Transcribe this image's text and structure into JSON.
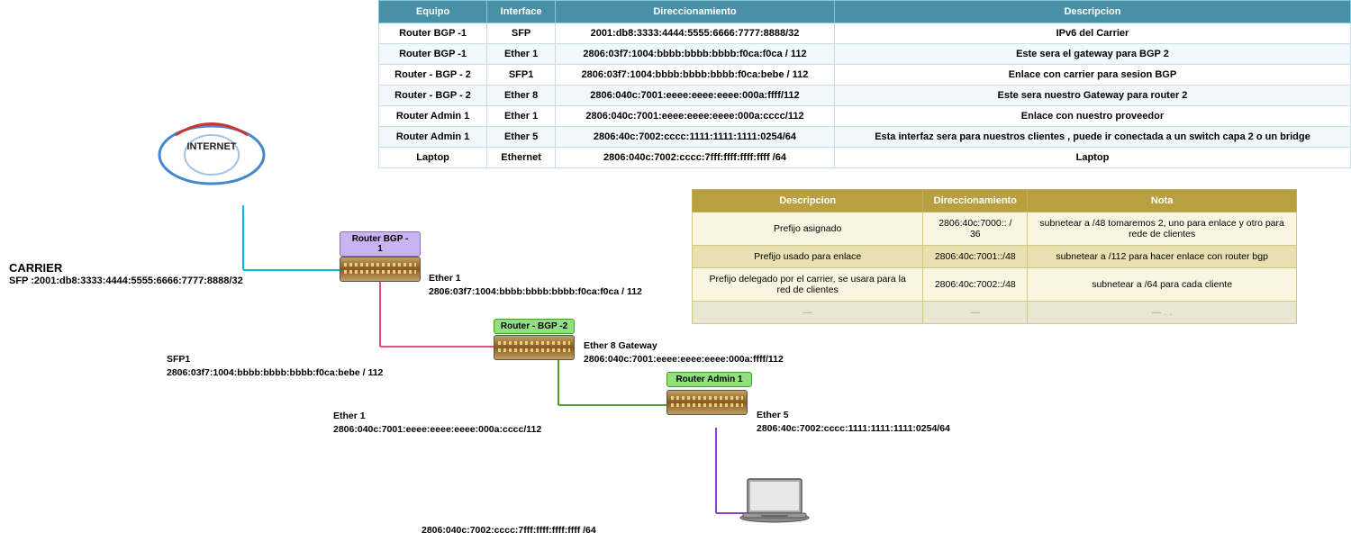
{
  "table1": {
    "headers": [
      "Equipo",
      "Interface",
      "Direccionamiento",
      "Descripcion"
    ],
    "rows": [
      {
        "equipo": "Router BGP -1",
        "interface": "SFP",
        "direccionamiento": "2001:db8:3333:4444:5555:6666:7777:8888/32",
        "descripcion": "IPv6 del Carrier"
      },
      {
        "equipo": "Router BGP -1",
        "interface": "Ether 1",
        "direccionamiento": "2806:03f7:1004:bbbb:bbbb:bbbb:f0ca:f0ca / 112",
        "descripcion": "Este sera el gateway para BGP 2"
      },
      {
        "equipo": "Router - BGP - 2",
        "interface": "SFP1",
        "direccionamiento": "2806:03f7:1004:bbbb:bbbb:bbbb:f0ca:bebe / 112",
        "descripcion": "Enlace con carrier para sesion BGP"
      },
      {
        "equipo": "Router - BGP - 2",
        "interface": "Ether 8",
        "direccionamiento": "2806:040c:7001:eeee:eeee:eeee:000a:ffff/112",
        "descripcion": "Este sera nuestro Gateway para router 2"
      },
      {
        "equipo": "Router Admin 1",
        "interface": "Ether 1",
        "direccionamiento": "2806:040c:7001:eeee:eeee:eeee:000a:cccc/112",
        "descripcion": "Enlace con nuestro proveedor"
      },
      {
        "equipo": "Router Admin 1",
        "interface": "Ether 5",
        "direccionamiento": "2806:40c:7002:cccc:1111:1111:1111:0254/64",
        "descripcion": "Esta interfaz sera para nuestros clientes , puede ir conectada a un switch capa 2 o un bridge"
      },
      {
        "equipo": "Laptop",
        "interface": "Ethernet",
        "direccionamiento": "2806:040c:7002:cccc:7fff:ffff:ffff:ffff /64",
        "descripcion": "Laptop"
      }
    ]
  },
  "table2": {
    "headers": [
      "Descripcion",
      "Direccionamiento",
      "Nota"
    ],
    "rows": [
      {
        "descripcion": "Prefijo asignado",
        "direccionamiento": "2806:40c:7000:: / 36",
        "nota": "subnetear a /48  tomaremos 2, uno para enlace y otro para rede de clientes"
      },
      {
        "descripcion": "Prefijo usado para enlace",
        "direccionamiento": "2806:40c:7001::/48",
        "nota": "subnetear a /112 para hacer enlace con router bgp"
      },
      {
        "descripcion": "Prefijo delegado por el carrier, se usara para la red de clientes",
        "direccionamiento": "2806:40c:7002::/48",
        "nota": "subnetear a /64 para cada cliente"
      },
      {
        "descripcion": "—",
        "direccionamiento": "—",
        "nota": "— . ."
      }
    ]
  },
  "diagram": {
    "internet_label": "INTERNET",
    "carrier_label": "CARRIER",
    "carrier_sfp": "SFP :2001:db8:3333:4444:5555:6666:7777:8888/32",
    "router_bgp1_label": "Router BGP -\n1",
    "router_bgp2_label": "Router - BGP -2",
    "router_admin1_label": "Router Admin 1",
    "ether1_bgp1": "Ether 1",
    "ether1_bgp1_addr": "2806:03f7:1004:bbbb:bbbb:bbbb:f0ca:f0ca / 112",
    "sfp1_bgp2": "SFP1",
    "sfp1_bgp2_addr": "2806:03f7:1004:bbbb:bbbb:bbbb:f0ca:bebe / 112",
    "ether8_bgp2": "Ether 8 Gateway",
    "ether8_bgp2_addr": "2806:040c:7001:eeee:eeee:eeee:000a:ffff/112",
    "ether1_admin1": "Ether 1",
    "ether1_admin1_addr": "2806:040c:7001:eeee:eeee:eeee:000a:cccc/112",
    "ether5_admin1": "Ether 5",
    "ether5_admin1_addr": "2806:40c:7002:cccc:1111:1111:1111:0254/64",
    "laptop_addr": "2806:040c:7002:cccc:7fff:ffff:ffff:ffff /64"
  }
}
